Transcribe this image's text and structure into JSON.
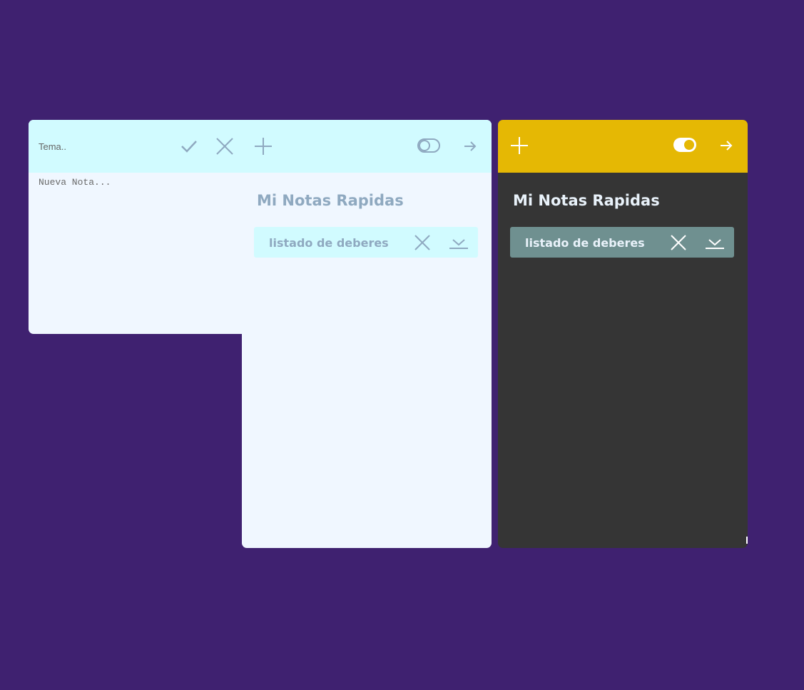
{
  "editor": {
    "topic_placeholder": "Tema..",
    "note_placeholder": "Nueva Nota...",
    "save_icon": "check-icon",
    "discard_icon": "close-icon"
  },
  "light_app": {
    "title": "Mi Notas Rapidas",
    "theme": "light",
    "header_color": "#d1fbff",
    "background_color": "#f0f7ff",
    "text_color": "#8fa9c0",
    "icons": [
      "plus-icon",
      "toggle-off-icon",
      "arrow-right-icon"
    ],
    "notes": [
      {
        "label": "listado de deberes",
        "icons": [
          "close-icon",
          "download-icon"
        ]
      }
    ]
  },
  "dark_app": {
    "title": "Mi Notas Rapidas",
    "theme": "dark",
    "header_color": "#e5b804",
    "background_color": "#353535",
    "text_color": "#e9f2fa",
    "icons": [
      "plus-icon",
      "toggle-on-icon",
      "arrow-right-icon"
    ],
    "notes": [
      {
        "label": "listado de deberes",
        "icons": [
          "close-icon",
          "download-icon"
        ]
      }
    ]
  },
  "colors": {
    "page_background": "#3f2170",
    "light_icon": "#8fa9c0",
    "dark_icon": "#ffffff",
    "note_item_dark": "#6f9090"
  }
}
